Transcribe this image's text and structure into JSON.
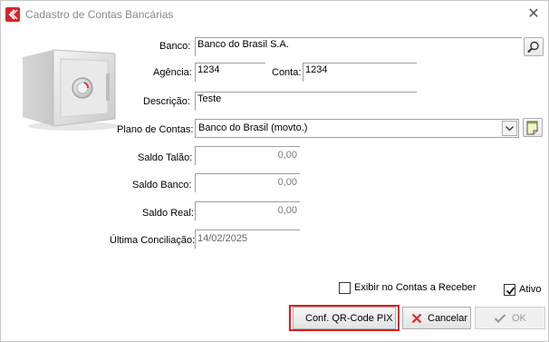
{
  "window": {
    "title": "Cadastro de Contas Bancárias",
    "close_glyph": "✕"
  },
  "form": {
    "banco": {
      "label": "Banco:",
      "value": "Banco do Brasil S.A."
    },
    "agencia": {
      "label": "Agência:",
      "value": "1234"
    },
    "conta": {
      "label": "Conta:",
      "value": "1234"
    },
    "descricao": {
      "label": "Descrição:",
      "value": "Teste"
    },
    "plano": {
      "label": "Plano de Contas:",
      "value": "Banco do Brasil (movto.)"
    },
    "saldo_talao": {
      "label": "Saldo Talão:",
      "value": "0,00"
    },
    "saldo_banco": {
      "label": "Saldo Banco:",
      "value": "0,00"
    },
    "saldo_real": {
      "label": "Saldo Real:",
      "value": "0,00"
    },
    "ultima_conciliacao": {
      "label": "Última Conciliação:",
      "value": "14/02/2025"
    }
  },
  "options": {
    "exibir_contas_receber": {
      "label": "Exibir no Contas a Receber",
      "checked": false
    },
    "ativo": {
      "label": "Ativo",
      "checked": true
    }
  },
  "buttons": {
    "qr_pix": "Conf. QR-Code PIX",
    "cancelar": "Cancelar",
    "ok": "OK"
  },
  "icons": {
    "app": "app-logo-icon",
    "search": "search-icon",
    "note": "note-icon",
    "safe": "safe-icon",
    "cancel": "x-icon",
    "ok": "check-icon"
  },
  "colors": {
    "highlight": "#e01a1a",
    "cancel_icon": "#e0282d",
    "app_icon": "#d6242c"
  }
}
